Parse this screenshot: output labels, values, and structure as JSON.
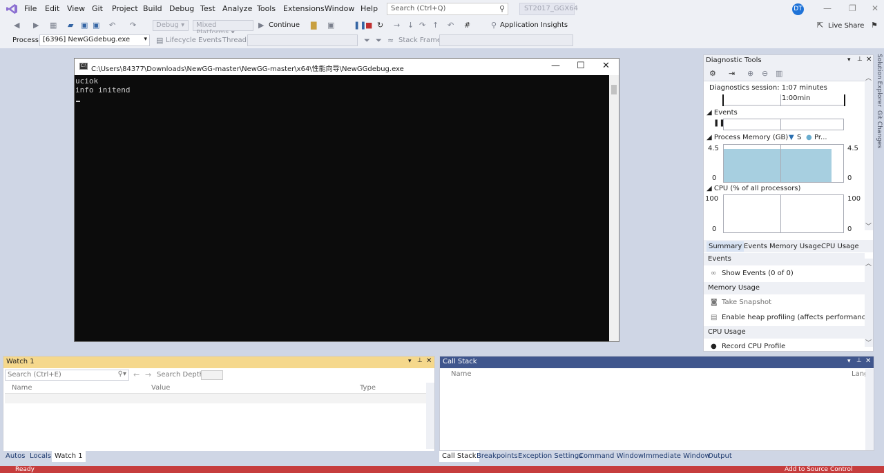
{
  "menu": [
    "File",
    "Edit",
    "View",
    "Git",
    "Project",
    "Build",
    "Debug",
    "Test",
    "Analyze",
    "Tools",
    "Extensions",
    "Window",
    "Help"
  ],
  "search": {
    "placeholder": "Search (Ctrl+Q)"
  },
  "solution_name": "ST2017_GGX64",
  "avatar_initials": "DT",
  "toolbar": {
    "config": "Debug",
    "platform": "Mixed Platforms",
    "continue_label": "Continue",
    "app_insights": "Application Insights",
    "live_share": "Live Share"
  },
  "debug_toolbar": {
    "process_label": "Process:",
    "process_value": "[6396] NewGGdebug.exe",
    "lifecycle": "Lifecycle Events",
    "thread_label": "Thread:",
    "stack_frame_label": "Stack Frame:"
  },
  "console": {
    "title": "C:\\Users\\84377\\Downloads\\NewGG-master\\NewGG-master\\x64\\性能向导\\NewGGdebug.exe",
    "icon_text": "C:\\",
    "lines": "uciok\ninfo initend"
  },
  "diagnostics": {
    "title": "Diagnostic Tools",
    "session": "Diagnostics session: 1:07 minutes",
    "timeline_label": "1:00min",
    "events_label": "Events",
    "memory_label": "Process Memory (GB)",
    "legend_s": "S",
    "legend_pr": "Pr...",
    "mem_max": "4.5",
    "mem_min": "0",
    "mem_fill_fraction": 1.0,
    "cpu_label": "CPU (% of all processors)",
    "cpu_max": "100",
    "cpu_min": "0",
    "tabs": [
      "Summary",
      "Events",
      "Memory Usage",
      "CPU Usage"
    ],
    "sec_events": "Events",
    "show_events": "Show Events (0 of 0)",
    "sec_memory": "Memory Usage",
    "take_snapshot": "Take Snapshot",
    "heap_profiling": "Enable heap profiling (affects performance)",
    "sec_cpu": "CPU Usage",
    "record_cpu": "Record CPU Profile"
  },
  "rail": {
    "solution_explorer": "Solution Explorer",
    "git_changes": "Git Changes"
  },
  "watch": {
    "title": "Watch 1",
    "search_placeholder": "Search (Ctrl+E)",
    "search_depth": "Search Depth:",
    "columns": [
      "Name",
      "Value",
      "Type"
    ],
    "tabs": [
      "Autos",
      "Locals",
      "Watch 1"
    ]
  },
  "callstack": {
    "title": "Call Stack",
    "columns": [
      "Name",
      "Lang"
    ],
    "tabs": [
      "Call Stack",
      "Breakpoints",
      "Exception Settings",
      "Command Window",
      "Immediate Window",
      "Output"
    ]
  },
  "status": {
    "ready": "Ready",
    "source_control": "Add to Source Control"
  }
}
